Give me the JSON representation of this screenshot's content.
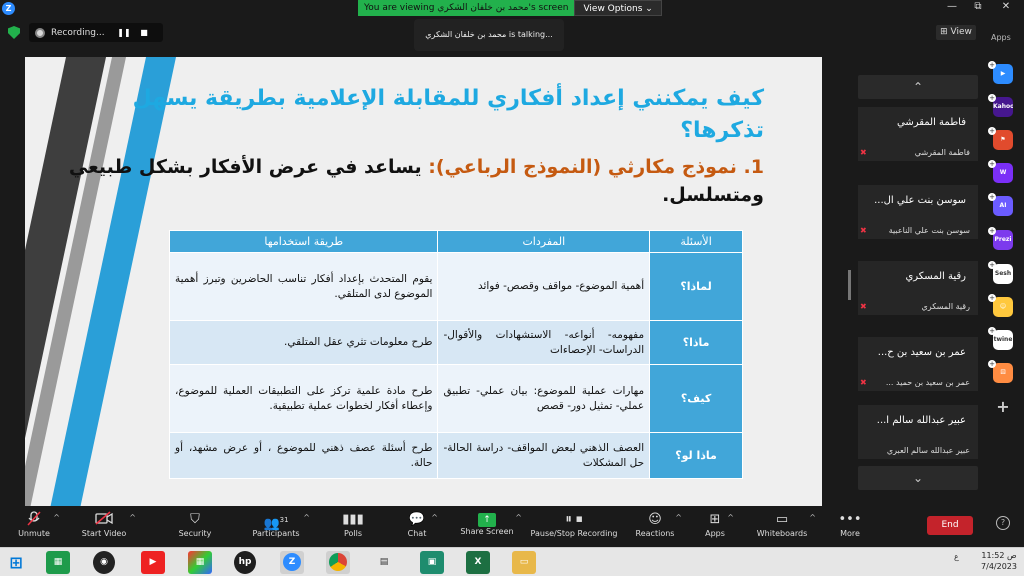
{
  "titlebar": {
    "logo": "Z",
    "viewing_text": "You are viewing محمد بن خلفان الشكري's screen",
    "view_options": "View Options ⌄",
    "min": "—",
    "max": "⧉",
    "close": "✕"
  },
  "recording": {
    "label": "Recording...",
    "pause": "❚❚",
    "stop": "■"
  },
  "talking": "محمد بن خلفان الشكري is talking...",
  "view_button": "⊞ View",
  "slide": {
    "title": "كيف يمكنني إعداد أفكاري للمقابلة الإعلامية بطريقة يسهل تذكرها؟",
    "subtitle_num": "1. نموذج مكارثي (النموذج الرباعي):",
    "subtitle_rest": " يساعد في عرض الأفكار بشكل طبيعي ومتسلسل.",
    "table": {
      "headers": [
        "الأسئلة",
        "المفردات",
        "طريقة استخدامها"
      ],
      "rows": [
        [
          "لماذا؟",
          "أهمية الموضوع- مواقف وقصص- فوائد",
          "يقوم المتحدث بإعداد أفكار تناسب الحاضرين وتبرز أهمية الموضوع لدى المتلقي."
        ],
        [
          "ماذا؟",
          "مفهومه- أنواعه- الاستشهادات والأقوال- الدراسات- الإحصاءات",
          "طرح معلومات تثري عقل المتلقي."
        ],
        [
          "كيف؟",
          "مهارات عملية للموضوع: بيان عملي- تطبيق عملي- تمثيل دور- قصص",
          "طرح مادة علمية تركز على التطبيقات العملية للموضوع، وإعطاء أفكار لخطوات عملية تطبيقية."
        ],
        [
          "ماذا لو؟",
          "العصف الذهني لبعض المواقف- دراسة الحالة- حل المشكلات",
          "طرح أسئلة عصف ذهني للموضوع ، أو عرض مشهد، أو حالة."
        ]
      ]
    }
  },
  "participants": {
    "up": "⌃",
    "down": "⌄",
    "tiles": [
      {
        "name": "فاطمة المقرشي",
        "sub": "فاطمة المقرشي"
      },
      {
        "name": "سوسن بنت علي ال...",
        "sub": "سوسن بنت علي الناعبية"
      },
      {
        "name": "رقية المسكري",
        "sub": "رقية المسكري"
      },
      {
        "name": "عمر بن سعيد بن ح...",
        "sub": "عمر بن سعيد بن حميد ..."
      },
      {
        "name": "عبير عبدالله سالم ا...",
        "sub": "عبير عبدالله سالم العبري"
      }
    ]
  },
  "apps": {
    "label": "Apps",
    "items": [
      {
        "name": "tv-app",
        "text": "▶",
        "color": "#2d8cff"
      },
      {
        "name": "kahoot-app",
        "text": "Kahoot!",
        "color": "#46178f"
      },
      {
        "name": "flag-app",
        "text": "⚑",
        "color": "#e14b2d"
      },
      {
        "name": "wooclap-app",
        "text": "W",
        "color": "#7b2ff7"
      },
      {
        "name": "ai-app",
        "text": "AI",
        "color": "#6b5cff"
      },
      {
        "name": "prezi-app",
        "text": "Prezi",
        "color": "#7c3aed"
      },
      {
        "name": "sesh-app",
        "text": "Sesh",
        "color": "#ffffff"
      },
      {
        "name": "emoji-app",
        "text": "☺",
        "color": "#ffc83d"
      },
      {
        "name": "twine-app",
        "text": "twine",
        "color": "#ffffff"
      },
      {
        "name": "dice-app",
        "text": "⚄",
        "color": "#ff8c42"
      },
      {
        "name": "add-app",
        "text": "+",
        "color": "transparent"
      }
    ]
  },
  "toolbar": {
    "unmute": "Unmute",
    "start_video": "Start Video",
    "security": "Security",
    "participants": "Participants",
    "participants_count": "31",
    "polls": "Polls",
    "chat": "Chat",
    "share_screen": "Share Screen",
    "pause_recording": "Pause/Stop Recording",
    "reactions": "Reactions",
    "apps": "Apps",
    "whiteboards": "Whiteboards",
    "more": "More",
    "end": "End",
    "help": "?"
  },
  "taskbar": {
    "time": "11:52 ص",
    "date": "7/4/2023",
    "lang": "ع"
  },
  "colors": {
    "accent": "#2d8cff",
    "share_green": "#22b14c",
    "end_red": "#c4232b",
    "slide_blue": "#41a6d9",
    "title_blue": "#1ea9e1"
  }
}
